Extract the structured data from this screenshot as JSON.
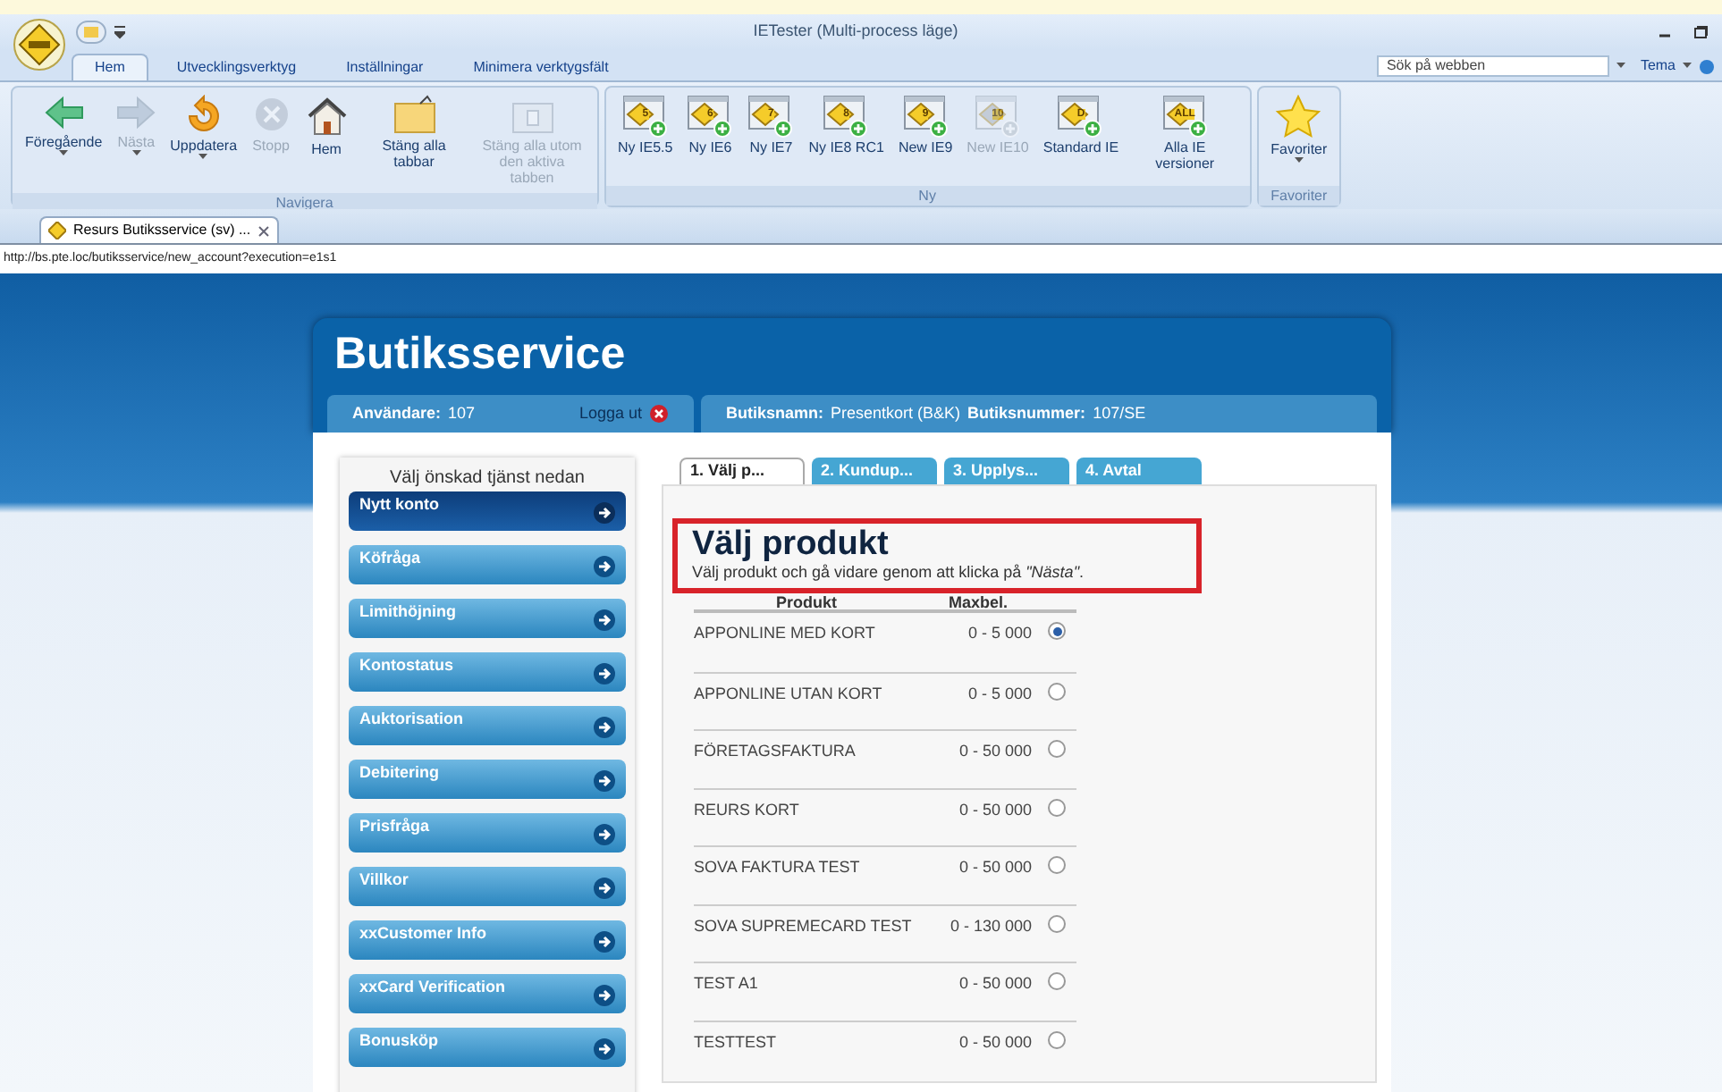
{
  "window": {
    "title": "IETester (Multi-process läge)"
  },
  "ribbon_tabs": [
    {
      "label": "Hem",
      "selected": true
    },
    {
      "label": "Utvecklingsverktyg",
      "selected": false
    },
    {
      "label": "Inställningar",
      "selected": false
    },
    {
      "label": "Minimera verktygsfält",
      "selected": false
    }
  ],
  "search": {
    "placeholder": "Sök på webben"
  },
  "theme_menu": "Tema",
  "ribbon_groups": [
    {
      "label": "Navigera",
      "buttons": [
        {
          "kind": "back",
          "label": "Föregående",
          "disabled": false,
          "dropdown": true
        },
        {
          "kind": "forward",
          "label": "Nästa",
          "disabled": true,
          "dropdown": true
        },
        {
          "kind": "refresh",
          "label": "Uppdatera",
          "disabled": false,
          "dropdown": true
        },
        {
          "kind": "stop",
          "label": "Stopp",
          "disabled": true,
          "dropdown": false
        },
        {
          "kind": "home",
          "label": "Hem",
          "disabled": false,
          "dropdown": false
        },
        {
          "kind": "folder",
          "label": "Stäng alla tabbar",
          "disabled": false,
          "dropdown": false
        },
        {
          "kind": "folder-one",
          "label": "Stäng alla utom den aktiva tabben",
          "disabled": true,
          "dropdown": false
        }
      ]
    },
    {
      "label": "Ny",
      "buttons": [
        {
          "kind": "ie",
          "badge": "5",
          "label": "Ny IE5.5",
          "disabled": false,
          "dropdown": false
        },
        {
          "kind": "ie",
          "badge": "6",
          "label": "Ny IE6",
          "disabled": false,
          "dropdown": false
        },
        {
          "kind": "ie",
          "badge": "7",
          "label": "Ny IE7",
          "disabled": false,
          "dropdown": false
        },
        {
          "kind": "ie",
          "badge": "8",
          "label": "Ny IE8 RC1",
          "disabled": false,
          "dropdown": false
        },
        {
          "kind": "ie",
          "badge": "9",
          "label": "New IE9",
          "disabled": false,
          "dropdown": false
        },
        {
          "kind": "ie",
          "badge": "10",
          "label": "New IE10",
          "disabled": true,
          "dropdown": false
        },
        {
          "kind": "ie",
          "badge": "D",
          "label": "Standard IE",
          "disabled": false,
          "dropdown": false
        },
        {
          "kind": "ie",
          "badge": "ALL",
          "label": "Alla IE versioner",
          "disabled": false,
          "dropdown": false
        }
      ]
    },
    {
      "label": "Favoriter",
      "buttons": [
        {
          "kind": "star",
          "label": "Favoriter",
          "disabled": false,
          "dropdown": true
        }
      ]
    }
  ],
  "browser_tabs": [
    {
      "label": "Resurs Butiksservice (sv) ...",
      "selected": true
    }
  ],
  "address": "http://bs.pte.loc/butiksservice/new_account?execution=e1s1",
  "site": {
    "title": "Butiksservice",
    "user_label": "Användare:",
    "user_value": "107",
    "logout": "Logga ut",
    "store_name_label": "Butiksnamn:",
    "store_name": "Presentkort (B&K)",
    "store_number_label": "Butiksnummer:",
    "store_number": "107/SE",
    "services_heading": "Välj önskad tjänst nedan",
    "services": [
      {
        "label": "Nytt konto",
        "selected": true
      },
      {
        "label": "Köfråga",
        "selected": false
      },
      {
        "label": "Limithöjning",
        "selected": false
      },
      {
        "label": "Kontostatus",
        "selected": false
      },
      {
        "label": "Auktorisation",
        "selected": false
      },
      {
        "label": "Debitering",
        "selected": false
      },
      {
        "label": "Prisfråga",
        "selected": false
      },
      {
        "label": "Villkor",
        "selected": false
      },
      {
        "label": "xxCustomer Info",
        "selected": false
      },
      {
        "label": "xxCard Verification",
        "selected": false
      },
      {
        "label": "Bonusköp",
        "selected": false
      }
    ],
    "steps": [
      {
        "label": "1. Välj p...",
        "selected": true
      },
      {
        "label": "2. Kundup...",
        "selected": false
      },
      {
        "label": "3. Upplys...",
        "selected": false
      },
      {
        "label": "4. Avtal",
        "selected": false
      }
    ],
    "heading": "Välj produkt",
    "instruction": "Välj produkt och gå vidare genom att klicka på *\"Nästa\"*.",
    "table": {
      "columns": [
        "Produkt",
        "Maxbel."
      ],
      "rows": [
        {
          "product": "APPONLINE MED KORT",
          "max": "0 - 5 000",
          "selected": true
        },
        {
          "product": "APPONLINE UTAN KORT",
          "max": "0 - 5 000",
          "selected": false
        },
        {
          "product": "FÖRETAGSFAKTURA",
          "max": "0 - 50 000",
          "selected": false
        },
        {
          "product": "REURS KORT",
          "max": "0 - 50 000",
          "selected": false
        },
        {
          "product": "SOVA FAKTURA TEST",
          "max": "0 - 50 000",
          "selected": false
        },
        {
          "product": "SOVA SUPREMECARD TEST",
          "max": "0 - 130 000",
          "selected": false
        },
        {
          "product": "TEST A1",
          "max": "0 - 50 000",
          "selected": false
        },
        {
          "product": "TESTTEST",
          "max": "0 - 50 000",
          "selected": false
        }
      ]
    }
  }
}
